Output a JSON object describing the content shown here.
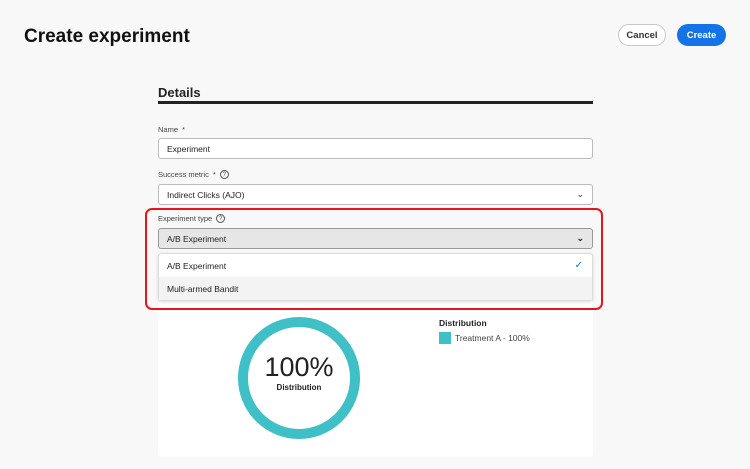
{
  "header": {
    "title": "Create experiment",
    "cancel_label": "Cancel",
    "create_label": "Create"
  },
  "details": {
    "heading": "Details",
    "name_label": "Name",
    "required_mark": "*",
    "name_value": "Experiment",
    "metric_label": "Success metric",
    "help_glyph": "?",
    "metric_value": "Indirect Clicks (AJO)",
    "type_label": "Experiment type",
    "type_value": "A/B Experiment",
    "type_options": [
      {
        "label": "A/B Experiment",
        "selected": true
      },
      {
        "label": "Multi-armed Bandit",
        "selected": false
      }
    ],
    "check_glyph": "✓",
    "chevron_glyph": "⌄"
  },
  "distribution": {
    "center_value": "100%",
    "center_label": "Distribution",
    "legend_title": "Distribution",
    "legend_item": "Treatment A - 100%",
    "color": "#3fbfc6"
  },
  "chart_data": {
    "type": "pie",
    "title": "Distribution",
    "categories": [
      "Treatment A"
    ],
    "values": [
      100
    ],
    "colors": [
      "#3fbfc6"
    ]
  }
}
